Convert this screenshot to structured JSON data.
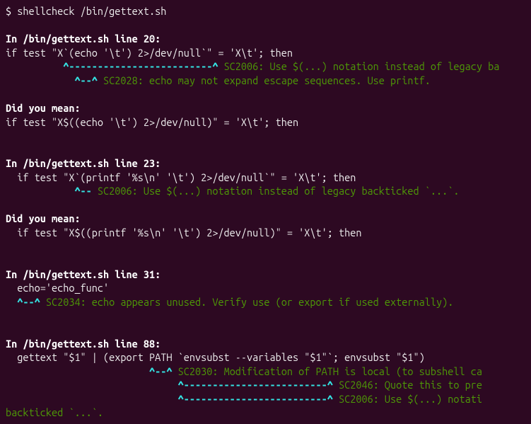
{
  "cmd": {
    "prompt": "$ ",
    "text": "shellcheck /bin/gettext.sh"
  },
  "blocks": [
    {
      "header": "In /bin/gettext.sh line 20:",
      "code": "if test \"X`(echo '\\t') 2>/dev/null`\" = 'X\\t'; then",
      "warn1_caret": "          ^-------------------------^ ",
      "warn1_msg": "SC2006: Use $(...) notation instead of legacy ba",
      "warn2_caret": "            ^--^ ",
      "warn2_msg": "SC2028: echo may not expand escape sequences. Use printf.",
      "mean_label": "Did you mean: ",
      "mean_code": "if test \"X$((echo '\\t') 2>/dev/null)\" = 'X\\t'; then"
    },
    {
      "header": "In /bin/gettext.sh line 23:",
      "code": "  if test \"X`(printf '%s\\n' '\\t') 2>/dev/null`\" = 'X\\t'; then",
      "warn1_caret": "            ^-- ",
      "warn1_msg": "SC2006: Use $(...) notation instead of legacy backticked `...`.",
      "mean_label": "Did you mean: ",
      "mean_code": "  if test \"X$((printf '%s\\n' '\\t') 2>/dev/null)\" = 'X\\t'; then"
    },
    {
      "header": "In /bin/gettext.sh line 31:",
      "code": "  echo='echo_func'",
      "warn1_caret": "  ^--^ ",
      "warn1_msg": "SC2034: echo appears unused. Verify use (or export if used externally)."
    },
    {
      "header": "In /bin/gettext.sh line 88:",
      "code": "  gettext \"$1\" | (export PATH `envsubst --variables \"$1\"`; envsubst \"$1\")",
      "warn1_caret": "                         ^--^ ",
      "warn1_msg": "SC2030: Modification of PATH is local (to subshell ca",
      "warn2_caret": "                              ^-------------------------^ ",
      "warn2_msg": "SC2046: Quote this to pre",
      "warn3_caret": "                              ^-------------------------^ ",
      "warn3_msg": "SC2006: Use $(...) notati",
      "trail": "backticked `...`."
    }
  ]
}
